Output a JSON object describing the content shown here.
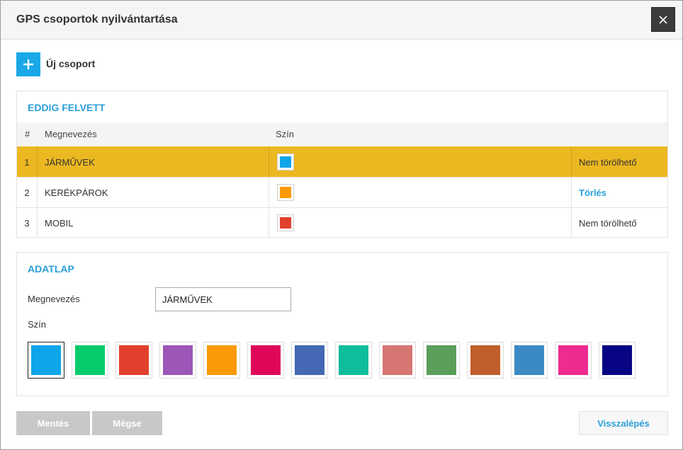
{
  "dialog": {
    "title": "GPS csoportok nyilvántartása",
    "close_icon": "close-icon"
  },
  "toolbar": {
    "new_icon": "plus-icon",
    "new_label": "Új csoport"
  },
  "list": {
    "title": "EDDIG FELVETT",
    "columns": {
      "num": "#",
      "name": "Megnevezés",
      "color": "Szín"
    },
    "rows": [
      {
        "num": "1",
        "name": "JÁRMŰVEK",
        "color": "#0ea5e9",
        "action": "Nem törölhető",
        "action_is_link": false,
        "selected": true
      },
      {
        "num": "2",
        "name": "KERÉKPÁROK",
        "color": "#fa9a06",
        "action": "Törlés",
        "action_is_link": true,
        "selected": false
      },
      {
        "num": "3",
        "name": "MOBIL",
        "color": "#e1412c",
        "action": "Nem törölhető",
        "action_is_link": false,
        "selected": false
      }
    ]
  },
  "form": {
    "title": "ADATLAP",
    "name_label": "Megnevezés",
    "name_value": "JÁRMŰVEK",
    "color_label": "Szín",
    "palette": [
      "#0ea5e9",
      "#06cc6c",
      "#e1412c",
      "#9c57b8",
      "#fa9a06",
      "#e0075a",
      "#4468b3",
      "#0fbd9c",
      "#d67672",
      "#5a9e5a",
      "#c15e2b",
      "#3c8ac4",
      "#ee2b91",
      "#080584"
    ],
    "palette_selected": 0
  },
  "actions": {
    "save": "Mentés",
    "cancel": "Mégse",
    "back": "Visszalépés"
  }
}
